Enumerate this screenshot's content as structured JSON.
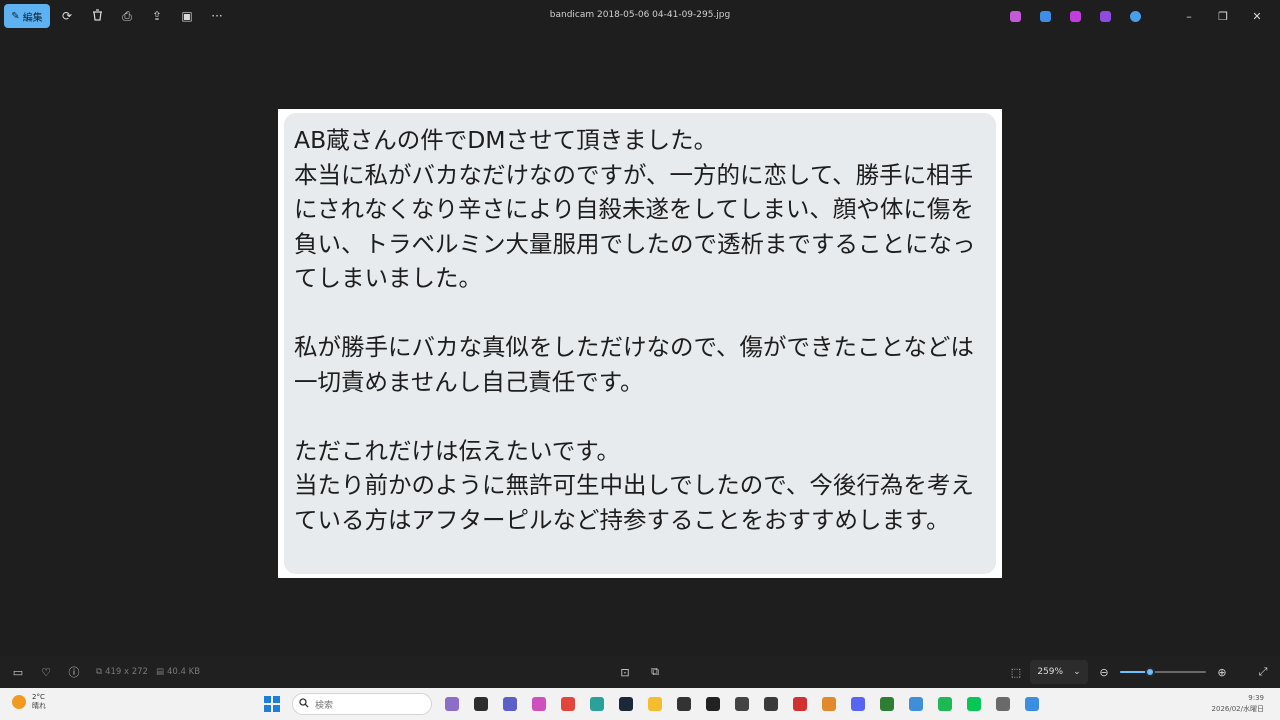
{
  "titlebar": {
    "edit_label": "編集",
    "title": "bandicam 2018-05-06 04-41-09-295.jpg",
    "tools": [
      {
        "name": "rotate-icon",
        "glyph": "⟳"
      },
      {
        "name": "delete-icon",
        "glyph": "🗑"
      },
      {
        "name": "print-icon",
        "glyph": "⎙"
      },
      {
        "name": "share-icon",
        "glyph": "⇪"
      },
      {
        "name": "slideshow-icon",
        "glyph": "▣"
      },
      {
        "name": "more-icon",
        "glyph": "···"
      }
    ],
    "app_icons": [
      {
        "name": "copilot-icon",
        "color": "#c45ad8"
      },
      {
        "name": "designer-icon",
        "color": "#3c8ee8"
      },
      {
        "name": "clipchamp-icon",
        "color": "#c13de0"
      },
      {
        "name": "photos-app-icon",
        "color": "#8f4ae0"
      },
      {
        "name": "onedrive-icon",
        "color": "#4aa0e8"
      }
    ],
    "window_controls": {
      "minimize": "–",
      "restore": "❐",
      "close": "✕"
    }
  },
  "image": {
    "paragraph1": "AB蔵さんの件でDMさせて頂きました。\n本当に私がバカなだけなのですが、一方的に恋して、勝手に相手にされなくなり辛さにより自殺未遂をしてしまい、顔や体に傷を負い、トラベルミン大量服用でしたので透析までするこ​とになってしまいました。",
    "paragraph2": "私が勝手にバカな真似をしただけなので、傷ができたことなどは一切責めませんし自己責任です。",
    "paragraph3": "ただこれだけは伝えたいです。\n当たり前かのように無許可生中出しでしたので、今後行為を考えている方はアフターピルなど持参することをおすすめします。"
  },
  "bottombar": {
    "dimensions": "419 x 272",
    "filesize": "40.4 KB",
    "zoom": "259%",
    "zoom_chevron": "⌄",
    "zoom_level": 0.35
  },
  "taskbar": {
    "temperature": "2°C",
    "weather": "晴れ",
    "search_placeholder": "検索",
    "time": "9:39",
    "date": "2026/02/水曜日",
    "apps": [
      {
        "name": "avatar-app-icon",
        "color": "#8a6ec8"
      },
      {
        "name": "file-explorer-icon",
        "color": "#2d2d2d"
      },
      {
        "name": "teams-icon",
        "color": "#5b5fc7"
      },
      {
        "name": "copilot-app-icon",
        "color": "#d04fbf"
      },
      {
        "name": "chrome-icon",
        "color": "#e2463b"
      },
      {
        "name": "app-icon-teal",
        "color": "#2aa198"
      },
      {
        "name": "steam-icon",
        "color": "#1b2838"
      },
      {
        "name": "folder-icon",
        "color": "#f3bd2f"
      },
      {
        "name": "app-icon-round",
        "color": "#333333"
      },
      {
        "name": "github-icon",
        "color": "#222222"
      },
      {
        "name": "piano-icon",
        "color": "#444444"
      },
      {
        "name": "app-icon-dark",
        "color": "#3a3a3a"
      },
      {
        "name": "record-icon",
        "color": "#d33030"
      },
      {
        "name": "app-icon-orange",
        "color": "#e2892b"
      },
      {
        "name": "discord-icon",
        "color": "#5865f2"
      },
      {
        "name": "terminal-icon",
        "color": "#2f7d32"
      },
      {
        "name": "notepad-icon",
        "color": "#3f8fd8"
      },
      {
        "name": "spotify-icon",
        "color": "#1db954"
      },
      {
        "name": "line-icon",
        "color": "#06c755"
      },
      {
        "name": "app-icon-pen",
        "color": "#6a6a6a"
      },
      {
        "name": "photos-icon",
        "color": "#3b8ee0"
      }
    ]
  }
}
